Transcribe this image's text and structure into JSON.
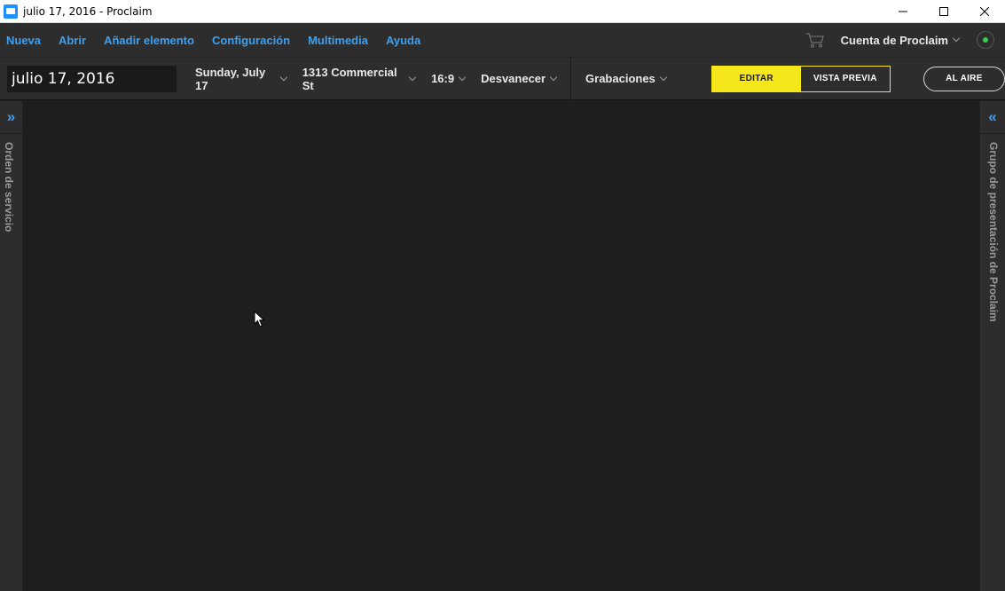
{
  "window": {
    "title": "julio 17, 2016 - Proclaim",
    "minimize": "—",
    "maximize": "☐",
    "close": "✕"
  },
  "menu": {
    "items": [
      "Nueva",
      "Abrir",
      "Añadir elemento",
      "Configuración",
      "Multimedia",
      "Ayuda"
    ],
    "account_label": "Cuenta de Proclaim"
  },
  "toolbar": {
    "date_value": "julio 17, 2016",
    "day": "Sunday, July 17",
    "location": "1313 Commercial St",
    "ratio": "16:9",
    "transition": "Desvanecer",
    "recordings": "Grabaciones",
    "edit_label": "EDITAR",
    "preview_label": "VISTA PREVIA",
    "on_air_label": "AL AIRE"
  },
  "panels": {
    "left_toggle": "»",
    "left_label": "Orden de servicio",
    "right_toggle": "«",
    "right_label": "Grupo de presentación de Proclaim"
  },
  "colors": {
    "accent_blue": "#3ea0f0",
    "accent_yellow": "#f6e71a",
    "status_green": "#35d04a",
    "background": "#1e1e1e",
    "chrome": "#2d2d2d"
  },
  "icons": {
    "cart": "cart-icon",
    "status": "connection-status-icon",
    "app": "proclaim-app-icon"
  }
}
